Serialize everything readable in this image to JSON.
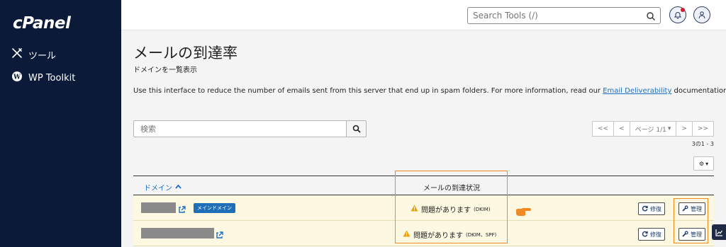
{
  "sidebar": {
    "logo": "cPanel",
    "items": [
      {
        "label": "ツール",
        "icon": "tools-icon"
      },
      {
        "label": "WP Toolkit",
        "icon": "wordpress-icon"
      }
    ]
  },
  "header": {
    "search_placeholder": "Search Tools (/)",
    "notification_icon": "bell-icon",
    "user_icon": "user-icon"
  },
  "page": {
    "title": "メールの到達率",
    "subtitle": "ドメインを一覧表示",
    "description_prefix": "Use this interface to reduce the number of emails sent from this server that end up in spam folders. For more information, read our ",
    "description_link": "Email Deliverability",
    "description_suffix": " documentation."
  },
  "filter": {
    "placeholder": "検索"
  },
  "pagination": {
    "first": "<<",
    "prev": "<",
    "page_label": "ページ 1/1",
    "next": ">",
    "last": ">>",
    "range_text": "3の1 - 3"
  },
  "table": {
    "col_domain": "ドメイン",
    "col_status": "メールの到達状況",
    "rows": [
      {
        "badge": "メインドメイン",
        "status_main": "問題があります",
        "status_detail": "(DKIM)",
        "repair": "修復",
        "manage": "管理"
      },
      {
        "badge": "",
        "status_main": "問題があります",
        "status_detail": "(DKIM、SPF)",
        "repair": "修復",
        "manage": "管理"
      }
    ]
  },
  "colors": {
    "sidebar_bg": "#0b1a38",
    "accent": "#1a6fc4",
    "warning": "#e8a20c",
    "highlight": "#f08a24",
    "row_warning_bg": "#fcf8e1"
  }
}
